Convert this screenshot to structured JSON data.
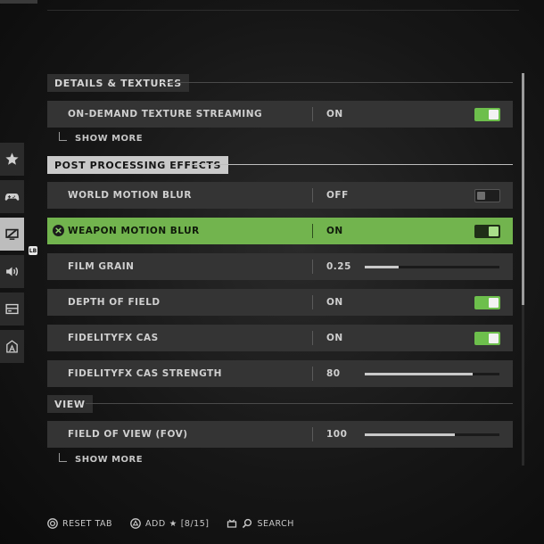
{
  "sections": {
    "details": {
      "title": "DETAILS & TEXTURES"
    },
    "post": {
      "title": "POST PROCESSING EFFECTS"
    },
    "view": {
      "title": "VIEW"
    }
  },
  "rows": {
    "texture_streaming": {
      "label": "ON-DEMAND TEXTURE STREAMING",
      "value": "ON",
      "toggle": true
    },
    "world_blur": {
      "label": "WORLD MOTION BLUR",
      "value": "OFF",
      "toggle": false
    },
    "weapon_blur": {
      "label": "WEAPON MOTION BLUR",
      "value": "ON",
      "toggle": true
    },
    "film_grain": {
      "label": "FILM GRAIN",
      "value": "0.25",
      "fill_fraction": 0.25
    },
    "depth_of_field": {
      "label": "DEPTH OF FIELD",
      "value": "ON",
      "toggle": true
    },
    "cas": {
      "label": "FIDELITYFX CAS",
      "value": "ON",
      "toggle": true
    },
    "cas_strength": {
      "label": "FIDELITYFX CAS STRENGTH",
      "value": "80",
      "fill_fraction": 0.8
    },
    "fov": {
      "label": "FIELD OF VIEW (FOV)",
      "value": "100",
      "fill_fraction": 0.67
    }
  },
  "show_more_label": "SHOW MORE",
  "side_tabs": [
    "star-icon",
    "controller-icon",
    "graphics-icon",
    "audio-icon",
    "interface-icon",
    "account-icon"
  ],
  "lb_hint": "LB",
  "footer": {
    "reset": "RESET TAB",
    "add": "ADD",
    "add_count": "[8/15]",
    "search": "SEARCH"
  },
  "colors": {
    "highlight": "#72b44e",
    "toggle_on": "#6dbf4c",
    "row_bg": "#343434"
  }
}
